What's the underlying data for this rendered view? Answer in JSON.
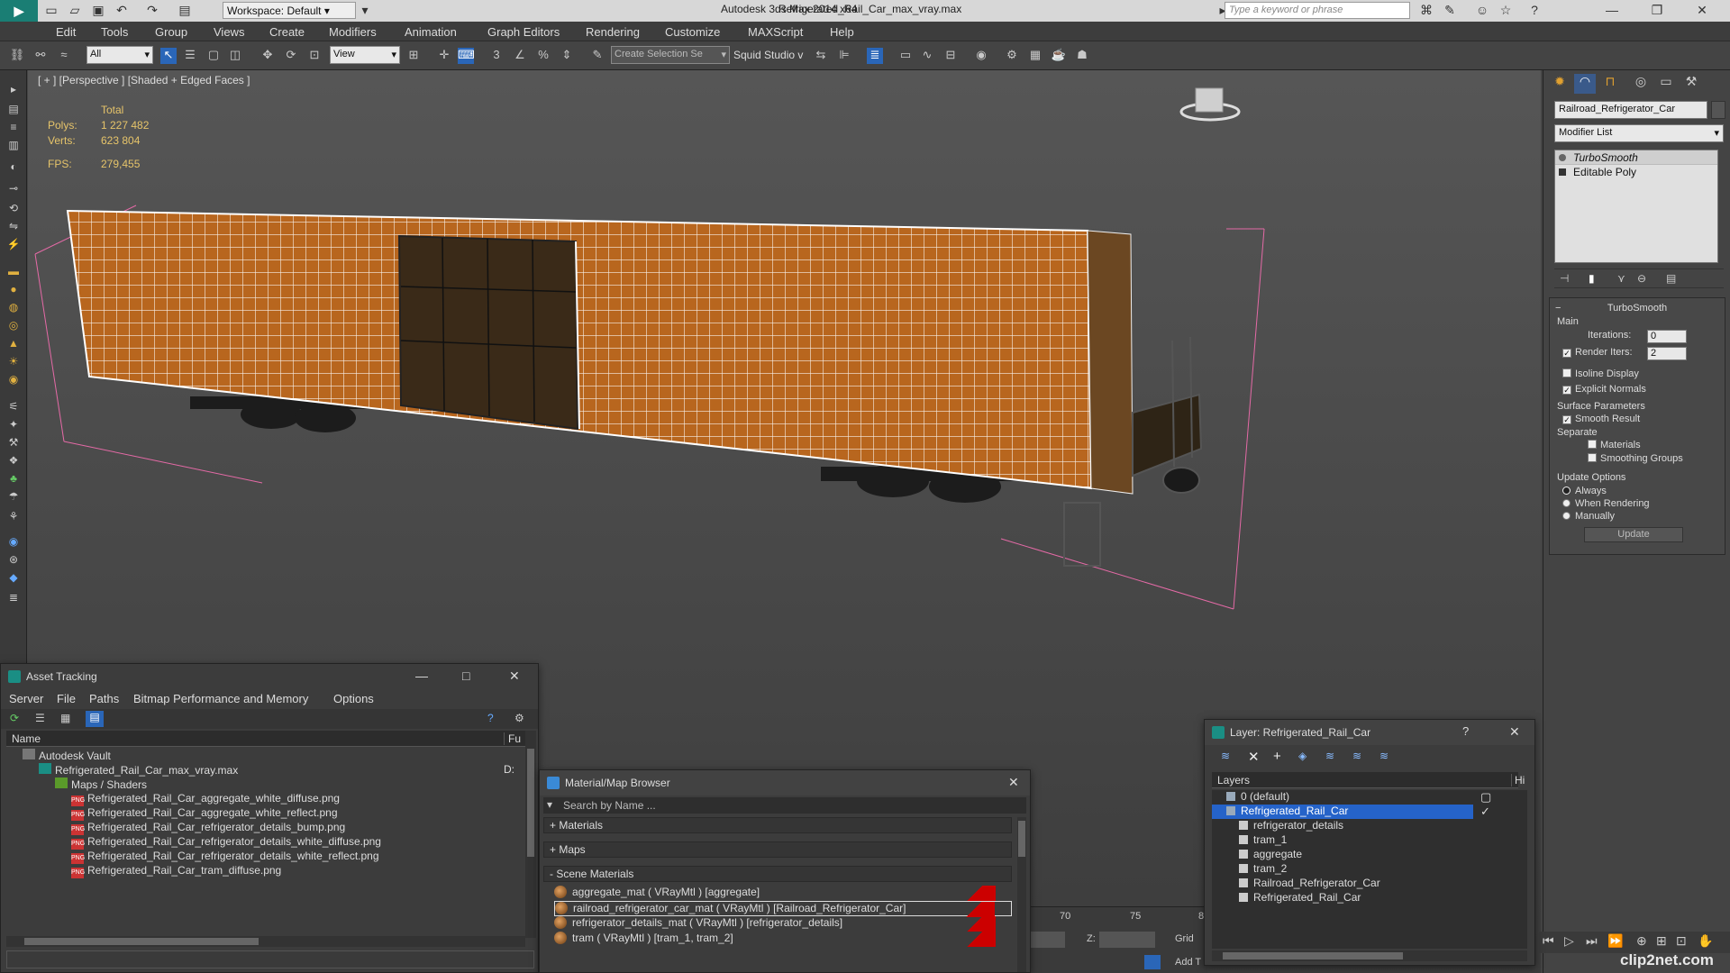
{
  "title_bar": {
    "workspace": "Workspace: Default",
    "app_title": "Autodesk 3ds Max  2014 x64",
    "file_title": "Refrigerated_Rail_Car_max_vray.max",
    "search_placeholder": "Type a keyword or phrase"
  },
  "menu": [
    "Edit",
    "Tools",
    "Group",
    "Views",
    "Create",
    "Modifiers",
    "Animation",
    "Graph Editors",
    "Rendering",
    "Customize",
    "MAXScript",
    "Help"
  ],
  "toolbar": {
    "filter": "All",
    "ref_coord": "View",
    "selection_set": "Create Selection Se",
    "squid": "Squid Studio v"
  },
  "viewport": {
    "label": "[ + ] [Perspective ] [Shaded + Edged Faces ]",
    "stats_total": "Total",
    "polys_label": "Polys:",
    "polys_value": "1 227 482",
    "verts_label": "Verts:",
    "verts_value": "623 804",
    "fps_label": "FPS:",
    "fps_value": "279,455"
  },
  "command_panel": {
    "object_name": "Railroad_Refrigerator_Car",
    "modifier_list": "Modifier List",
    "stack": [
      "TurboSmooth",
      "Editable Poly"
    ],
    "turbosmooth": {
      "title": "TurboSmooth",
      "main": "Main",
      "iterations_label": "Iterations:",
      "iterations_value": "0",
      "render_iters_label": "Render Iters:",
      "render_iters_value": "2",
      "isoline": "Isoline Display",
      "explicit": "Explicit Normals",
      "surface_params": "Surface Parameters",
      "smooth_result": "Smooth Result",
      "separate": "Separate",
      "materials": "Materials",
      "smoothing_groups": "Smoothing Groups",
      "update_options": "Update Options",
      "always": "Always",
      "when_rendering": "When Rendering",
      "manually": "Manually",
      "update_button": "Update"
    }
  },
  "asset_tracking": {
    "title": "Asset Tracking",
    "menu": [
      "Server",
      "File",
      "Paths",
      "Bitmap Performance and Memory",
      "Options"
    ],
    "col_name": "Name",
    "col_fu": "Fu",
    "rows": [
      {
        "text": "Autodesk Vault",
        "indent": 1,
        "type": "vault",
        "fu": ""
      },
      {
        "text": "Refrigerated_Rail_Car_max_vray.max",
        "indent": 2,
        "type": "max",
        "fu": "D:"
      },
      {
        "text": "Maps / Shaders",
        "indent": 3,
        "type": "maps",
        "fu": ""
      },
      {
        "text": "Refrigerated_Rail_Car_aggregate_white_diffuse.png",
        "indent": 4,
        "type": "png",
        "fu": ""
      },
      {
        "text": "Refrigerated_Rail_Car_aggregate_white_reflect.png",
        "indent": 4,
        "type": "png",
        "fu": ""
      },
      {
        "text": "Refrigerated_Rail_Car_refrigerator_details_bump.png",
        "indent": 4,
        "type": "png",
        "fu": ""
      },
      {
        "text": "Refrigerated_Rail_Car_refrigerator_details_white_diffuse.png",
        "indent": 4,
        "type": "png",
        "fu": ""
      },
      {
        "text": "Refrigerated_Rail_Car_refrigerator_details_white_reflect.png",
        "indent": 4,
        "type": "png",
        "fu": ""
      },
      {
        "text": "Refrigerated_Rail_Car_tram_diffuse.png",
        "indent": 4,
        "type": "png",
        "fu": ""
      }
    ]
  },
  "material_browser": {
    "title": "Material/Map Browser",
    "search_placeholder": "Search by Name ...",
    "groups": [
      "+ Materials",
      "+ Maps",
      "- Scene Materials"
    ],
    "materials": [
      "aggregate_mat  ( VRayMtl )  [aggregate]",
      "railroad_refrigerator_car_mat  ( VRayMtl )  [Railroad_Refrigerator_Car]",
      "refrigerator_details_mat  ( VRayMtl )  [refrigerator_details]",
      "tram  ( VRayMtl )  [tram_1, tram_2]"
    ]
  },
  "layer_window": {
    "title": "Layer: Refrigerated_Rail_Car",
    "col_layers": "Layers",
    "col_hi": "Hi",
    "rows": [
      {
        "text": "0 (default)",
        "indent": 1,
        "selected": false
      },
      {
        "text": "Refrigerated_Rail_Car",
        "indent": 1,
        "selected": true
      },
      {
        "text": "refrigerator_details",
        "indent": 2,
        "selected": false
      },
      {
        "text": "tram_1",
        "indent": 2,
        "selected": false
      },
      {
        "text": "aggregate",
        "indent": 2,
        "selected": false
      },
      {
        "text": "tram_2",
        "indent": 2,
        "selected": false
      },
      {
        "text": "Railroad_Refrigerator_Car",
        "indent": 2,
        "selected": false
      },
      {
        "text": "Refrigerated_Rail_Car",
        "indent": 2,
        "selected": false
      }
    ]
  },
  "timeline": {
    "tick_70": "70",
    "tick_75": "75",
    "tick_8": "8",
    "z_label": "Z:",
    "grid_label": "Grid",
    "add_label": "Add T"
  },
  "watermark": "clip2net.com",
  "colors": {
    "accent": "#e0a030",
    "selection": "#2563c9",
    "train_body": "#b8661e"
  }
}
